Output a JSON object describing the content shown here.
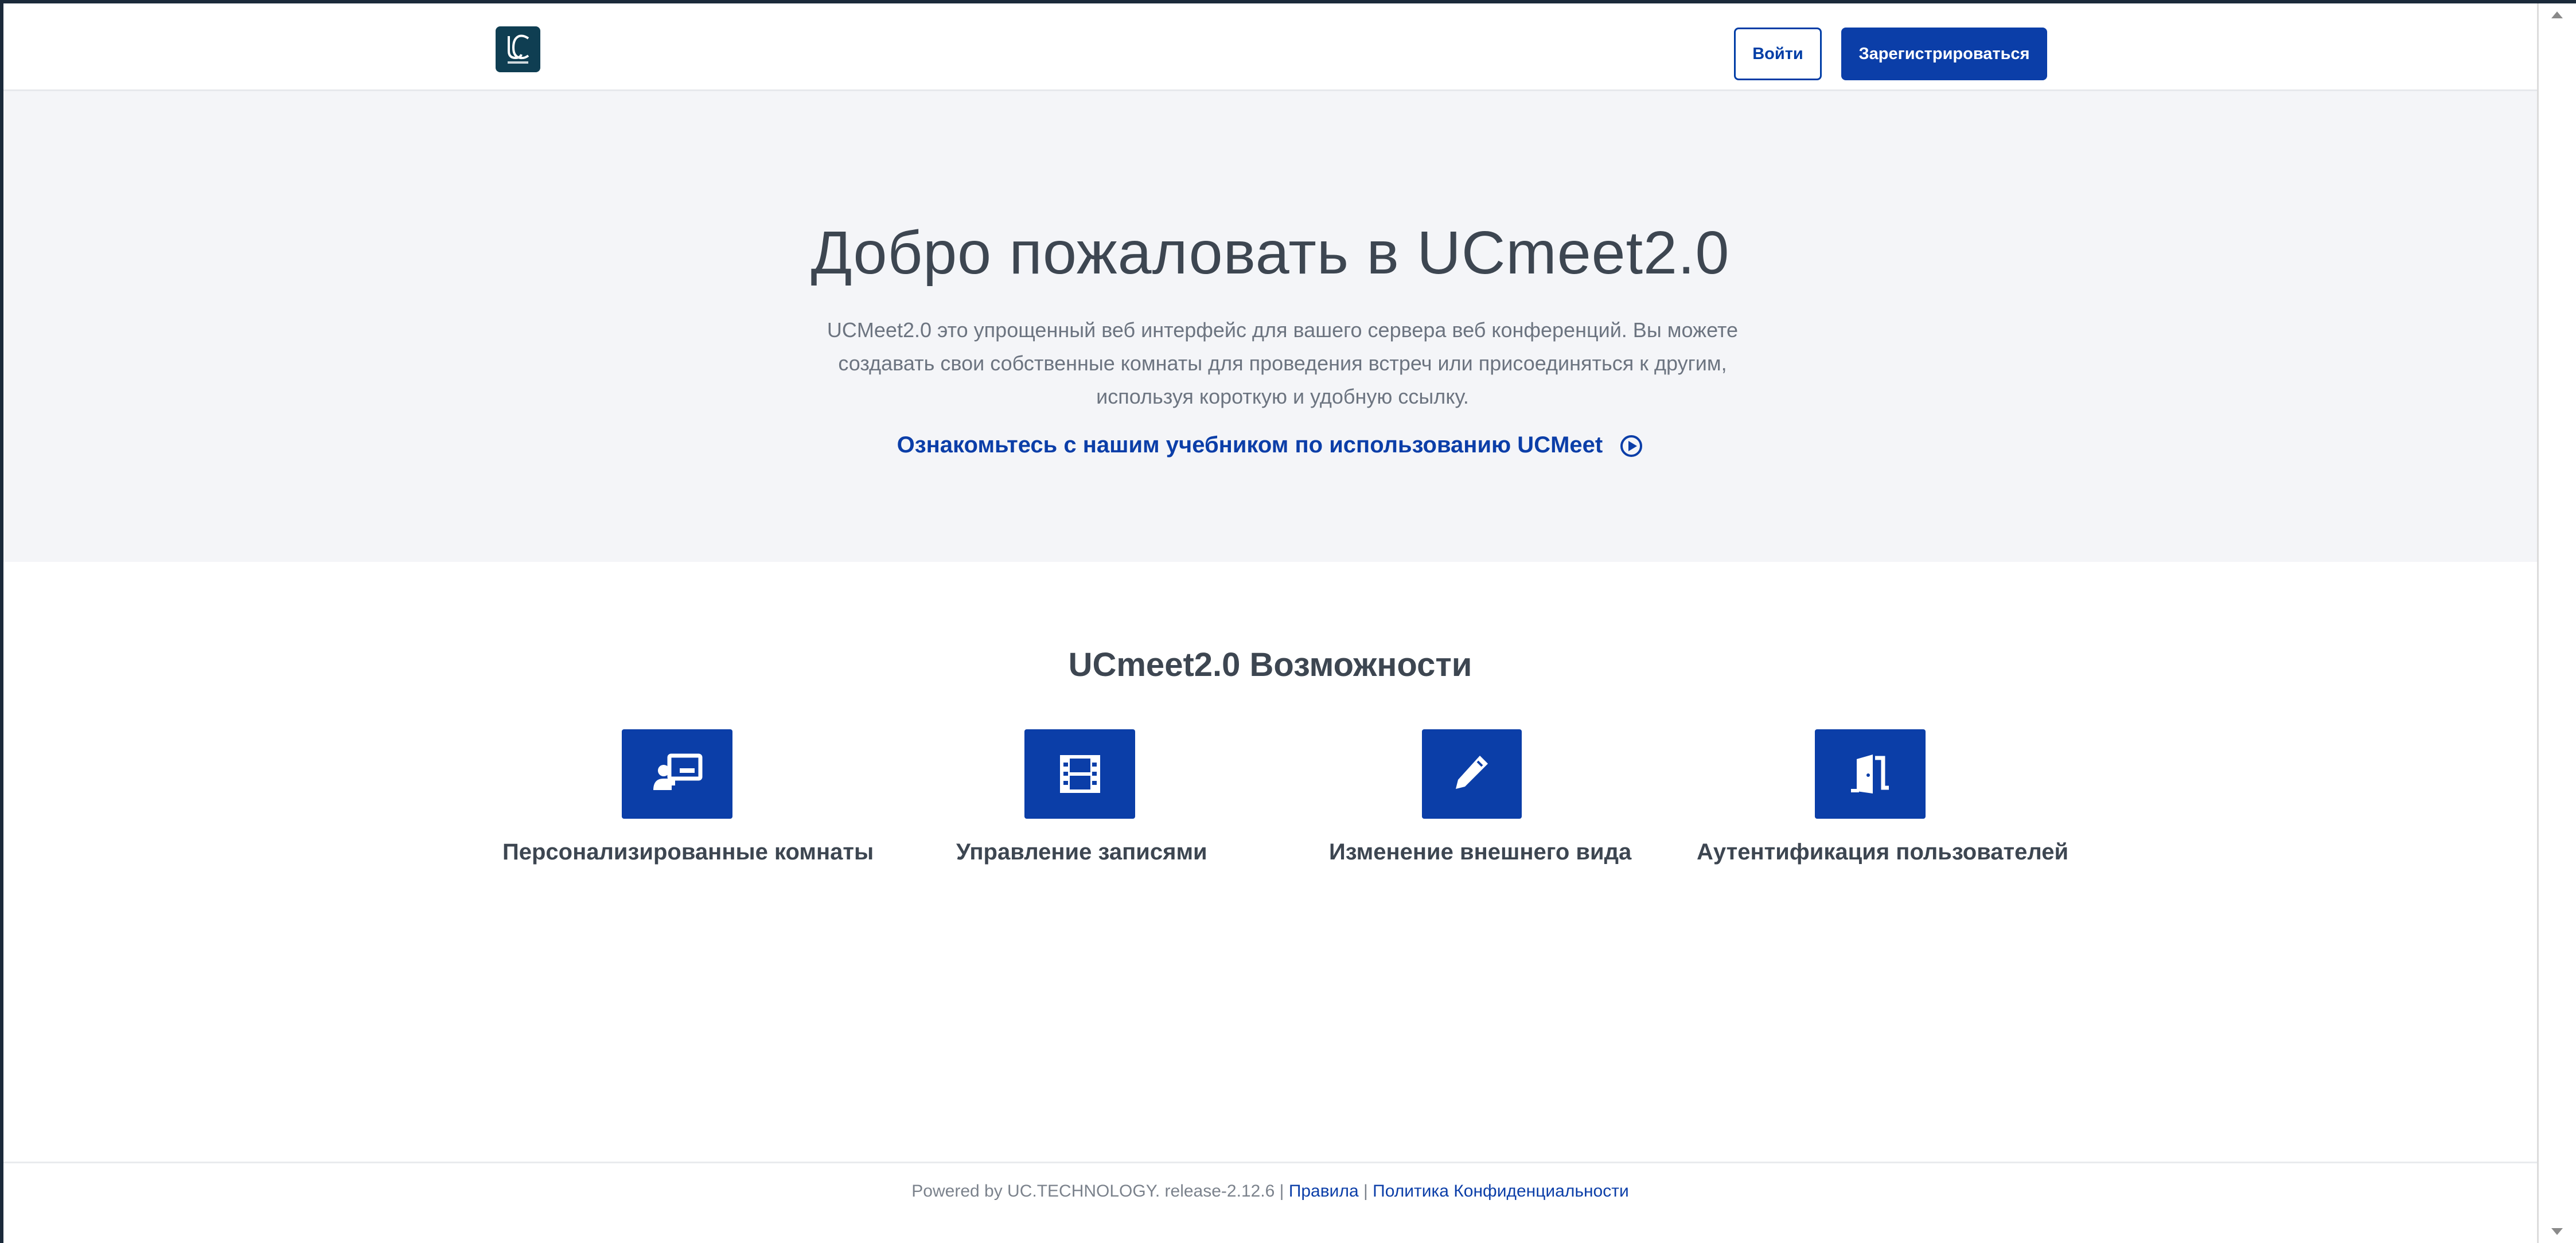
{
  "header": {
    "logo_icon": "ucmeet-logo",
    "login_label": "Войти",
    "signup_label": "Зарегистрироваться"
  },
  "hero": {
    "title": "Добро пожаловать в UCmeet2.0",
    "description_line1": "UCMeet2.0 это упрощенный веб интерфейс для вашего сервера веб конференций. Вы можете",
    "description_line2": "создавать свои собственные комнаты для проведения встреч или присоединяться к другим,",
    "description_line3": "используя короткую и удобную ссылку.",
    "tutorial_link": "Ознакомьтесь с нашим учебником по использованию UCMeet",
    "tutorial_icon": "play-circle-icon"
  },
  "features": {
    "title": "UCmeet2.0 Возможности",
    "items": [
      {
        "label": "Персонализированные комнаты",
        "icon": "chalkboard-teacher-icon"
      },
      {
        "label": "Управление записями",
        "icon": "film-icon"
      },
      {
        "label": "Изменение внешнего вида",
        "icon": "pencil-icon"
      },
      {
        "label": "Аутентификация пользователей",
        "icon": "door-open-icon"
      }
    ]
  },
  "footer": {
    "powered_text": "Powered by UC.TECHNOLOGY. release-2.12.6",
    "separator": "|",
    "terms_link": "Правила",
    "privacy_link": "Политика Конфиденциальности"
  },
  "colors": {
    "primary": "#0b3ea8",
    "hero_bg": "#f4f5f8",
    "heading": "#3d4651",
    "logo_bg": "#0f3e52"
  }
}
